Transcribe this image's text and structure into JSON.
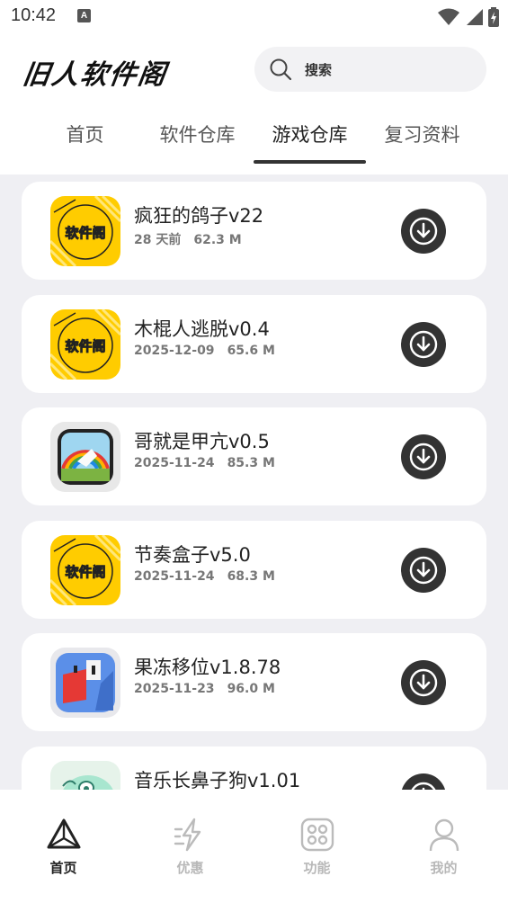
{
  "status": {
    "time": "10:42",
    "indicator": "A"
  },
  "header": {
    "logo": "旧人软件阁",
    "search_placeholder": "搜索"
  },
  "tabs": [
    {
      "label": "首页",
      "active": false
    },
    {
      "label": "软件仓库",
      "active": false
    },
    {
      "label": "游戏仓库",
      "active": true
    },
    {
      "label": "复习资料",
      "active": false
    }
  ],
  "apps": [
    {
      "name": "疯狂的鸽子v22",
      "date": "28 天前",
      "size": "62.3 M",
      "icon": "yellow-logo",
      "icon_text": "软件阁"
    },
    {
      "name": "木棍人逃脱v0.4",
      "date": "2025-12-09",
      "size": "65.6 M",
      "icon": "yellow-logo",
      "icon_text": "软件阁"
    },
    {
      "name": "哥就是甲亢v0.5",
      "date": "2025-11-24",
      "size": "85.3 M",
      "icon": "rainbow-game"
    },
    {
      "name": "节奏盒子v5.0",
      "date": "2025-11-24",
      "size": "68.3 M",
      "icon": "yellow-logo",
      "icon_text": "软件阁"
    },
    {
      "name": "果冻移位v1.8.78",
      "date": "2025-11-23",
      "size": "96.0 M",
      "icon": "blue-block-game"
    },
    {
      "name": "音乐长鼻子狗v1.01",
      "date": "",
      "size": "",
      "icon": "green-dog-game"
    }
  ],
  "bottom_nav": [
    {
      "label": "首页",
      "icon": "triangle-icon",
      "active": true
    },
    {
      "label": "优惠",
      "icon": "lightning-icon",
      "active": false
    },
    {
      "label": "功能",
      "icon": "grid-icon",
      "active": false
    },
    {
      "label": "我的",
      "icon": "user-icon",
      "active": false
    }
  ],
  "colors": {
    "accent": "#333333",
    "logo_yellow": "#ffcc00",
    "list_bg": "#efeff3"
  }
}
